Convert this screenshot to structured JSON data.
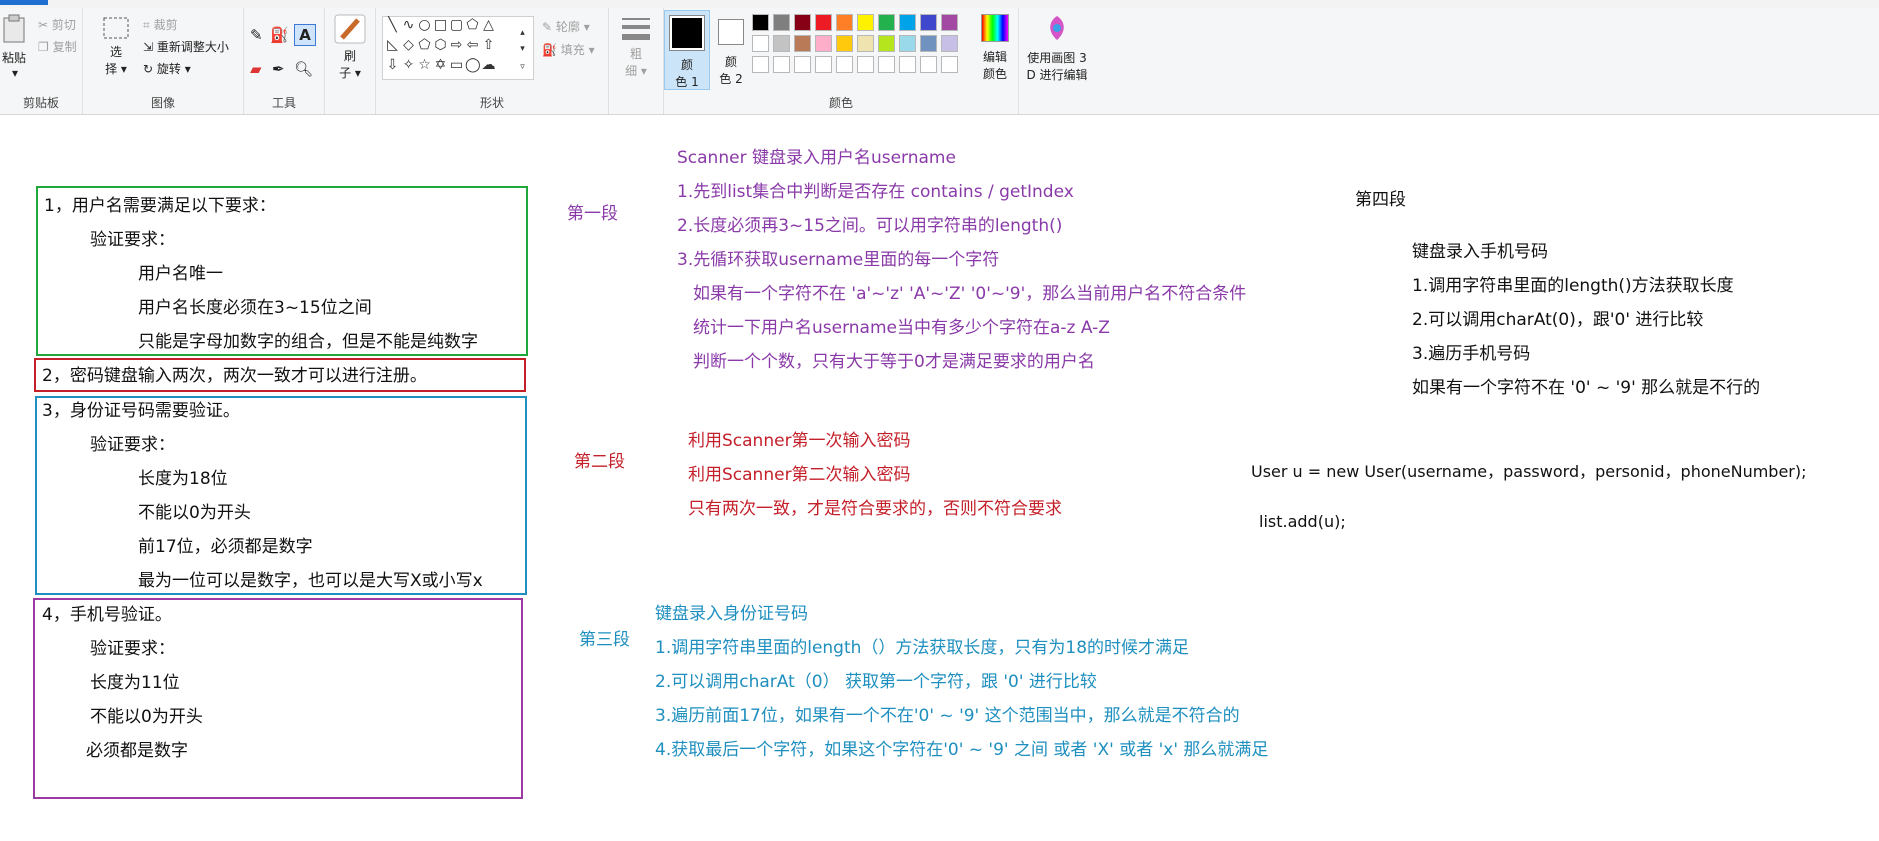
{
  "ribbon": {
    "clipboard": {
      "paste": "粘贴",
      "cut": "剪切",
      "copy": "复制",
      "group": "剪贴板"
    },
    "image": {
      "select_l1": "选",
      "select_l2": "择",
      "crop": "裁剪",
      "resize": "重新调整大小",
      "rotate": "旋转",
      "group": "图像"
    },
    "tools": {
      "group": "工具"
    },
    "brushes": {
      "l1": "刷",
      "l2": "子"
    },
    "shapes": {
      "outline": "轮廓",
      "fill": "填充",
      "group": "形状"
    },
    "size": {
      "l1": "粗",
      "l2": "细"
    },
    "color1": {
      "l1": "颜",
      "l2": "色 1"
    },
    "color2": {
      "l1": "颜",
      "l2": "色 2"
    },
    "edit_colors": {
      "l1": "编辑",
      "l2": "颜色"
    },
    "paint3d": {
      "l1": "使用画图 3",
      "l2": "D 进行编辑"
    },
    "colors_group": "颜色",
    "palette_row1": [
      "#000000",
      "#7f7f7f",
      "#880015",
      "#ed1c24",
      "#ff7f27",
      "#fff200",
      "#22b14c",
      "#00a2e8",
      "#3f48cc",
      "#a349a4"
    ],
    "palette_row2": [
      "#ffffff",
      "#c3c3c3",
      "#b97a57",
      "#ffaec9",
      "#ffc90e",
      "#efe4b0",
      "#b5e61d",
      "#99d9ea",
      "#7092be",
      "#c8bfe7"
    ]
  },
  "left": {
    "req1": {
      "title": "1，用户名需要满足以下要求：",
      "sub": "验证要求：",
      "items": [
        "用户名唯一",
        "用户名长度必须在3~15位之间",
        "只能是字母加数字的组合，但是不能是纯数字"
      ]
    },
    "req2": {
      "title": "2，密码键盘输入两次，两次一致才可以进行注册。"
    },
    "req3": {
      "title": "3，身份证号码需要验证。",
      "sub": "验证要求：",
      "items": [
        "长度为18位",
        "不能以0为开头",
        "前17位，必须都是数字",
        "最为一位可以是数字，也可以是大写X或小写x"
      ]
    },
    "req4": {
      "title": "4，手机号验证。",
      "sub": "验证要求：",
      "items": [
        "长度为11位",
        "不能以0为开头",
        "必须都是数字"
      ]
    }
  },
  "labels": {
    "p1": "第一段",
    "p2": "第二段",
    "p3": "第三段",
    "p4": "第四段"
  },
  "seg1": [
    "Scanner 键盘录入用户名username",
    "1.先到list集合中判断是否存在  contains / getIndex",
    "2.长度必须再3~15之间。可以用字符串的length()",
    "3.先循环获取username里面的每一个字符",
    "如果有一个字符不在 'a'~'z'  'A'~'Z'  '0'~'9'，那么当前用户名不符合条件",
    "统计一下用户名username当中有多少个字符在a-z A-Z",
    "判断一个个数，只有大于等于0才是满足要求的用户名"
  ],
  "seg2": [
    "利用Scanner第一次输入密码",
    "利用Scanner第二次输入密码",
    "只有两次一致，才是符合要求的，否则不符合要求"
  ],
  "seg3": [
    "键盘录入身份证号码",
    "1.调用字符串里面的length（）方法获取长度，只有为18的时候才满足",
    "2.可以调用charAt（0） 获取第一个字符，跟 '0'  进行比较",
    "3.遍历前面17位，如果有一个不在'0' ~ '9' 这个范围当中，那么就是不符合的",
    "4.获取最后一个字符，如果这个字符在'0' ~ '9' 之间 或者 'X' 或者 'x' 那么就满足"
  ],
  "seg4": [
    "键盘录入手机号码",
    "1.调用字符串里面的length()方法获取长度",
    "2.可以调用charAt(0)，跟'0' 进行比较",
    "3.遍历手机号码",
    "如果有一个字符不在 '0' ~ '9' 那么就是不行的"
  ],
  "code": {
    "line1": "User u = new User(username，password，personid，phoneNumber);",
    "line2": "list.add(u);"
  },
  "colors": {
    "green": "#22a83a",
    "red": "#c4202a",
    "blue": "#1e8fbf",
    "purple": "#9b3aa0"
  }
}
